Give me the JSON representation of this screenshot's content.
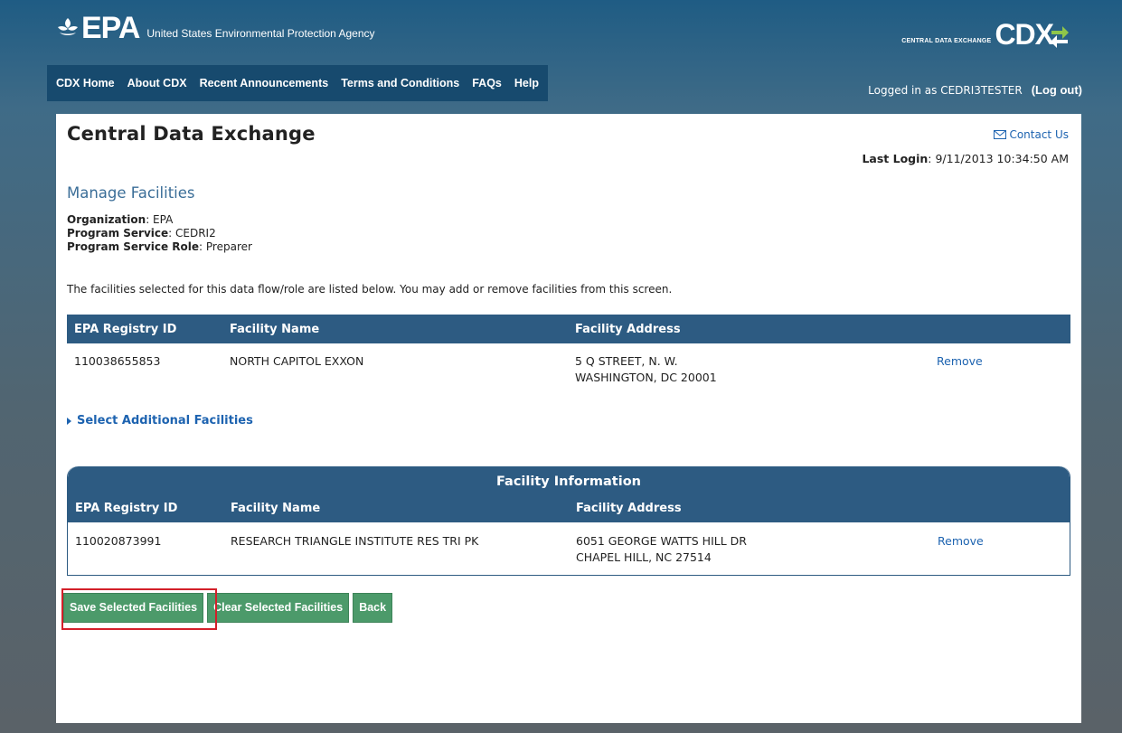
{
  "header": {
    "epa_logo_text": "EPA",
    "agency_name": "United States Environmental Protection Agency",
    "cdx_small": "CENTRAL DATA EXCHANGE",
    "cdx_big": "CDX"
  },
  "nav": {
    "items": [
      "CDX Home",
      "About CDX",
      "Recent Announcements",
      "Terms and Conditions",
      "FAQs",
      "Help"
    ],
    "logged_in_text": "Logged in as CEDRI3TESTER",
    "logout": "(Log out)"
  },
  "page": {
    "title": "Central Data Exchange",
    "contact_us": "Contact Us",
    "last_login_label": "Last Login",
    "last_login_value": ": 9/11/2013 10:34:50 AM",
    "section_title": "Manage Facilities",
    "organization_label": "Organization",
    "organization_value": ": EPA",
    "program_service_label": "Program Service",
    "program_service_value": ": CEDRI2",
    "role_label": "Program Service Role",
    "role_value": ": Preparer",
    "description": "The facilities selected for this data flow/role are listed below. You may add or remove facilities from this screen."
  },
  "selected_table": {
    "headers": [
      "EPA Registry ID",
      "Facility Name",
      "Facility Address"
    ],
    "rows": [
      {
        "id": "110038655853",
        "name": "NORTH CAPITOL EXXON",
        "address_line1": "5 Q STREET, N. W.",
        "address_line2": "WASHINGTON, DC 20001",
        "action": "Remove"
      }
    ]
  },
  "select_additional": "Select Additional Facilities",
  "info_table": {
    "caption": "Facility Information",
    "headers": [
      "EPA Registry ID",
      "Facility Name",
      "Facility Address"
    ],
    "rows": [
      {
        "id": "110020873991",
        "name": "RESEARCH TRIANGLE INSTITUTE RES TRI PK",
        "address_line1": "6051 GEORGE WATTS HILL DR",
        "address_line2": "CHAPEL HILL, NC 27514",
        "action": "Remove"
      }
    ]
  },
  "buttons": {
    "save": "Save Selected Facilities",
    "clear": "Clear Selected Facilities",
    "back": "Back"
  },
  "colors": {
    "header_blue": "#2d5b82",
    "button_green": "#4c9a6a",
    "link_blue": "#1d63b0",
    "highlight_red": "#d3202a"
  }
}
